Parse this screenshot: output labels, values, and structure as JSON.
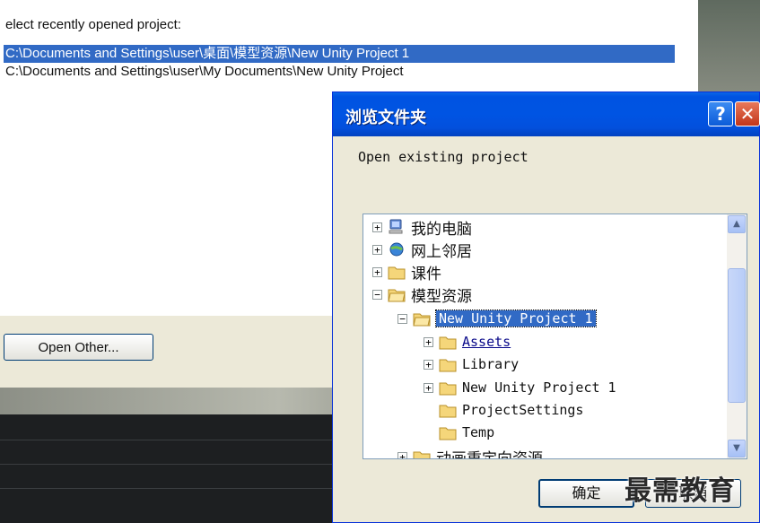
{
  "background_window": {
    "recent_label": "elect recently opened project:",
    "recent_projects": [
      "C:\\Documents and Settings\\user\\桌面\\模型资源\\New Unity Project 1",
      "C:\\Documents and Settings\\user\\My Documents\\New Unity Project"
    ],
    "open_other_label": "Open Other..."
  },
  "dialog": {
    "title": "浏览文件夹",
    "help_glyph": "?",
    "close_glyph": "✕",
    "prompt": "Open existing project",
    "tree": [
      {
        "label": "我的电脑",
        "expander": "+",
        "icon": "computer-icon"
      },
      {
        "label": "网上邻居",
        "expander": "+",
        "icon": "network-icon"
      },
      {
        "label": "课件",
        "expander": "+",
        "icon": "folder-icon"
      },
      {
        "label": "模型资源",
        "expander": "−",
        "icon": "folder-open-icon"
      },
      {
        "label": "New Unity Project 1",
        "expander": "−",
        "icon": "folder-open-icon",
        "selected": true
      },
      {
        "label": "Assets",
        "expander": "+",
        "icon": "folder-icon"
      },
      {
        "label": "Library",
        "expander": "+",
        "icon": "folder-icon"
      },
      {
        "label": "New Unity Project 1",
        "expander": "+",
        "icon": "folder-icon"
      },
      {
        "label": "ProjectSettings",
        "expander": "",
        "icon": "folder-icon"
      },
      {
        "label": "Temp",
        "expander": "",
        "icon": "folder-icon"
      },
      {
        "label": "动画重定向资源",
        "expander": "+",
        "icon": "folder-icon"
      }
    ],
    "ok_label": "确定",
    "cancel_label": "取消"
  },
  "watermark": "最需教育",
  "colors": {
    "selection": "#316ac5",
    "titlebar": "#0054e3",
    "dialog_bg": "#ece9d8"
  }
}
